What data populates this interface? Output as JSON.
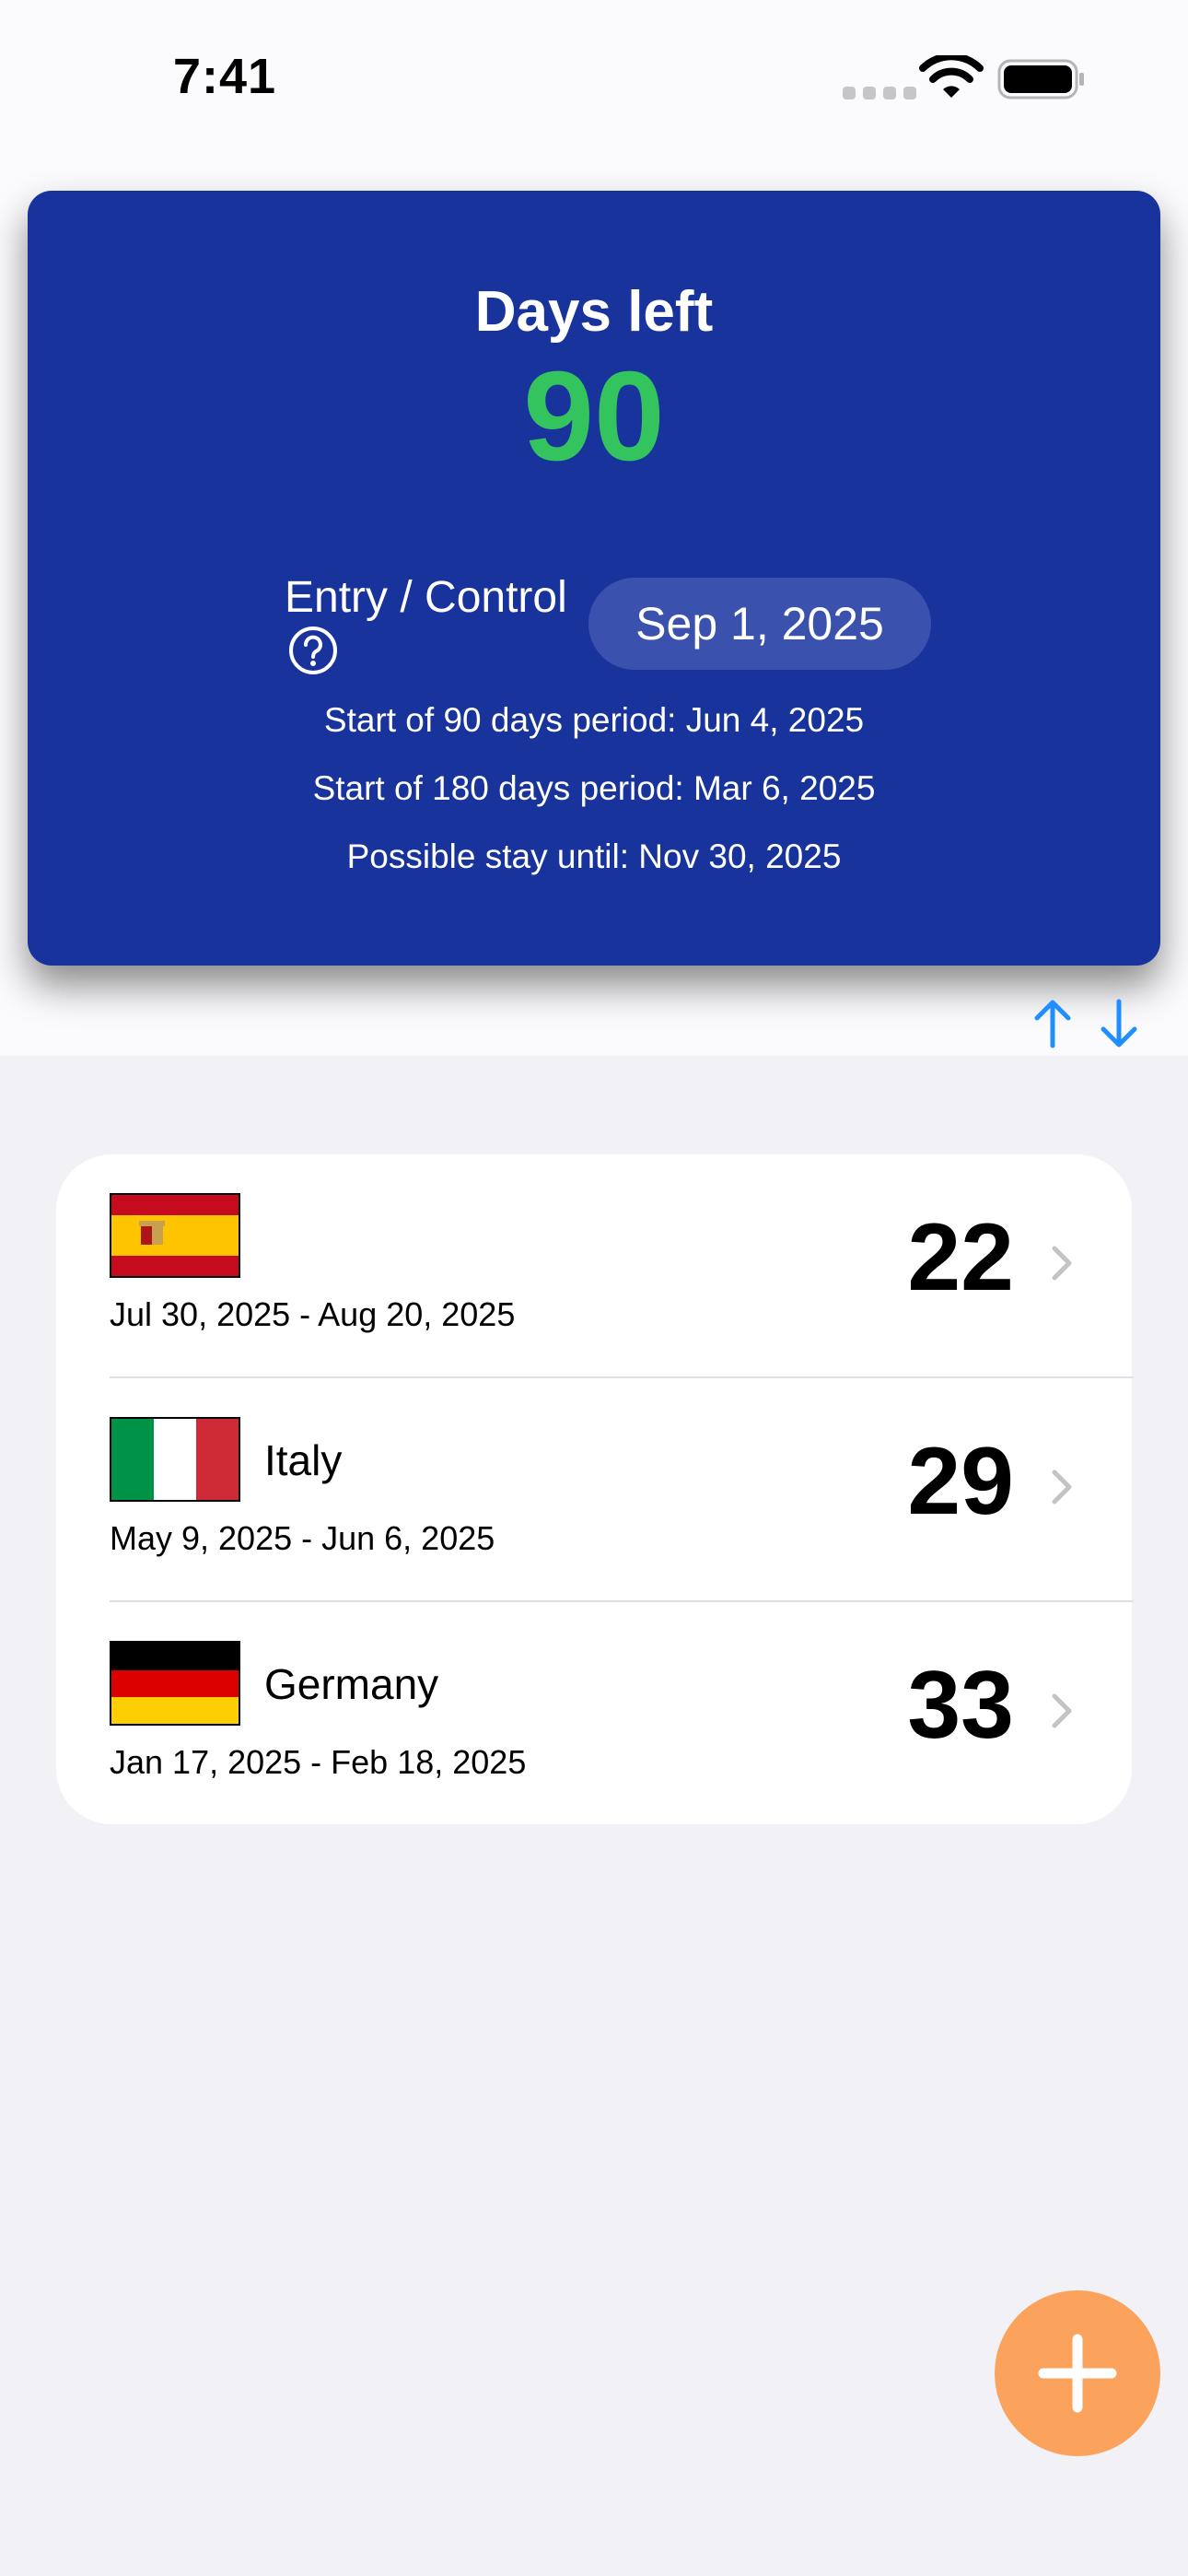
{
  "status_bar": {
    "time": "7:41"
  },
  "summary": {
    "days_left_label": "Days left",
    "days_left_value": "90",
    "entry_label": "Entry / Control",
    "entry_date": "Sep 1, 2025",
    "period_90_start": "Start of 90 days period: Jun 4, 2025",
    "period_180_start": "Start of 180 days period: Mar 6, 2025",
    "possible_stay": "Possible stay until: Nov 30, 2025"
  },
  "trips": [
    {
      "country": "",
      "flag": "spain-flag",
      "dates": "Jul 30, 2025 - Aug 20, 2025",
      "days": "22"
    },
    {
      "country": "Italy",
      "flag": "italy-flag",
      "dates": "May 9, 2025 - Jun 6, 2025",
      "days": "29"
    },
    {
      "country": "Germany",
      "flag": "germany-flag",
      "dates": "Jan 17, 2025 - Feb 18, 2025",
      "days": "33"
    }
  ],
  "icons": {
    "help": "help-icon",
    "sort_up": "arrow-up-icon",
    "sort_down": "arrow-down-icon",
    "chevron": "chevron-right-icon",
    "add": "plus-icon"
  },
  "colors": {
    "card_background": "#19339c",
    "days_left_value": "#33c45e",
    "accent_blue": "#1f8fff",
    "add_button": "#fba35c"
  }
}
